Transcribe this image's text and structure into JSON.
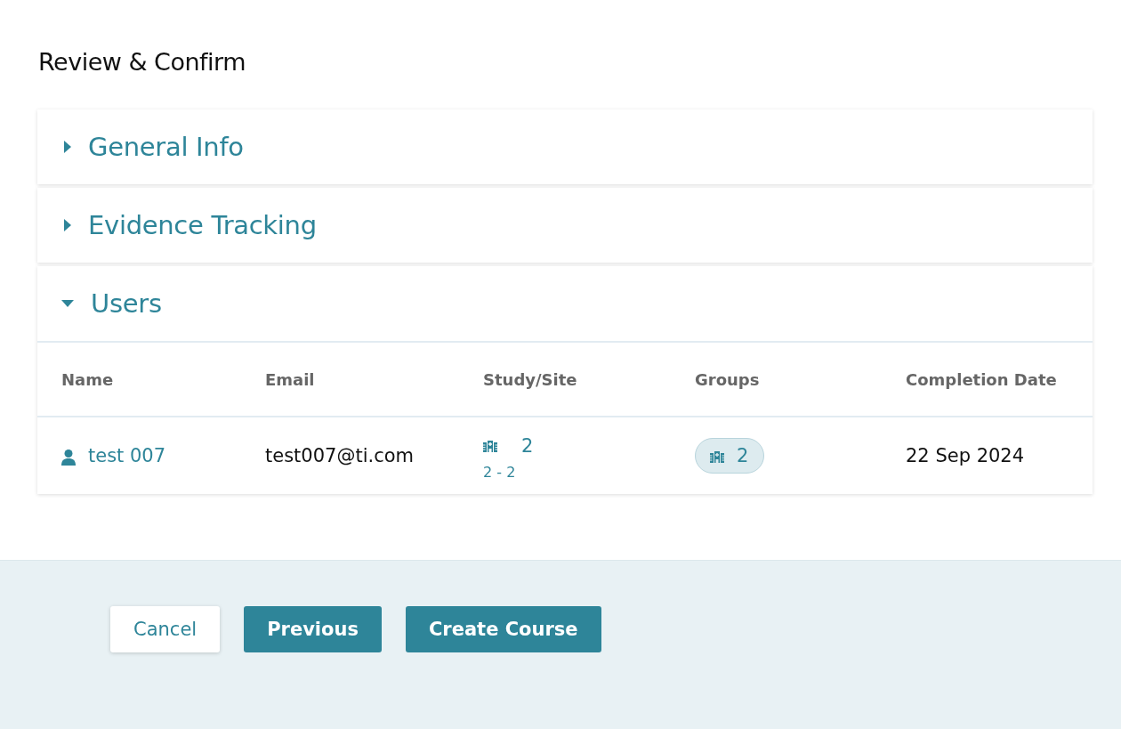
{
  "page_title": "Review & Confirm",
  "sections": [
    {
      "title": "General Info",
      "expanded": false
    },
    {
      "title": "Evidence Tracking",
      "expanded": false
    },
    {
      "title": "Users",
      "expanded": true,
      "table": {
        "columns": [
          "Name",
          "Email",
          "Study/Site",
          "Groups",
          "Completion Date"
        ],
        "rows": [
          {
            "name": "test 007",
            "email": "test007@ti.com",
            "study_count": "2",
            "study_range": "2 - 2",
            "groups": "2",
            "completion_date": "22 Sep 2024"
          }
        ]
      }
    }
  ],
  "buttons": [
    {
      "label": "Cancel",
      "kind": "secondary"
    },
    {
      "label": "Previous",
      "kind": "primary"
    },
    {
      "label": "Create Course",
      "kind": "primary"
    }
  ]
}
